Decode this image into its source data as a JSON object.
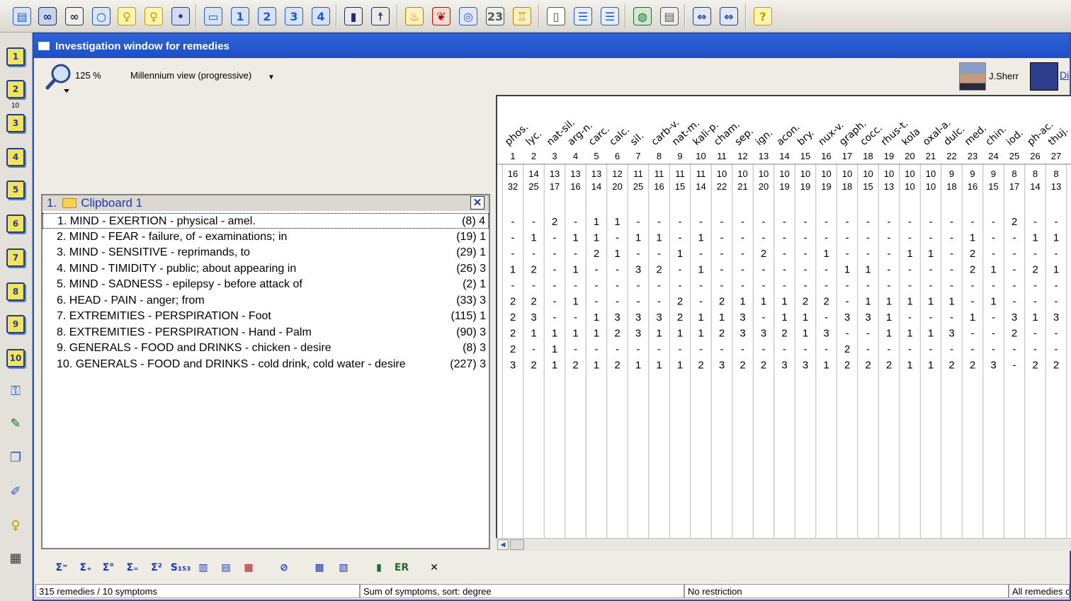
{
  "toolbar": {
    "buttons": [
      "open-book-icon",
      "binoculars-icon",
      "glasses-icon",
      "magnifier-icon",
      "lightbulb-icon",
      "lightbulb-pen-icon",
      "pills-icon",
      "clipboard-icon",
      "clipboard-1-icon",
      "clipboard-2-icon",
      "clipboard-3-icon",
      "clipboard-4-icon",
      "chart-icon",
      "person-chart-icon",
      "flame-icon",
      "insect-icon",
      "circle-icon",
      "numbers-icon",
      "tall-icon",
      "document-add-icon",
      "document-list-icon",
      "document-edit-icon",
      "globe-icon",
      "printer-icon",
      "handshake-icon",
      "handshake2-icon",
      "help-icon"
    ],
    "help_label": "?"
  },
  "sidebar": {
    "books": [
      "1",
      "2",
      "3",
      "4",
      "5",
      "6",
      "7",
      "8",
      "9",
      "10"
    ],
    "count_label": "10",
    "tools": [
      "key-icon",
      "notebook-icon",
      "copy-icon",
      "pencil-icon",
      "lightbulb-icon",
      "map-icon"
    ]
  },
  "window": {
    "title": "Investigation window for remedies",
    "zoom": "125 %",
    "view_mode": "Millennium view (progressive)",
    "user": "J.Sherr",
    "dia_label": "Di"
  },
  "clipboard": {
    "index_label": "1.",
    "title": "Clipboard 1",
    "close_label": "✕",
    "symptoms": [
      {
        "label": "1. MIND - EXERTION - physical - amel.",
        "count": "(8) 4"
      },
      {
        "label": "2. MIND - FEAR - failure, of - examinations; in",
        "count": "(19) 1"
      },
      {
        "label": "3. MIND - SENSITIVE - reprimands, to",
        "count": "(29) 1"
      },
      {
        "label": "4. MIND - TIMIDITY - public; about appearing in",
        "count": "(26) 3"
      },
      {
        "label": "5. MIND - SADNESS - epilepsy - before attack of",
        "count": "(2) 1"
      },
      {
        "label": "6. HEAD - PAIN - anger; from",
        "count": "(33) 3"
      },
      {
        "label": "7. EXTREMITIES - PERSPIRATION - Foot",
        "count": "(115) 1"
      },
      {
        "label": "8. EXTREMITIES - PERSPIRATION - Hand - Palm",
        "count": "(90) 3"
      },
      {
        "label": "9. GENERALS - FOOD and DRINKS - chicken - desire",
        "count": "(8) 3"
      },
      {
        "label": "10. GENERALS - FOOD and DRINKS - cold drink, cold water - desire",
        "count": "(227) 3"
      }
    ]
  },
  "grid": {
    "remedies": [
      "phos.",
      "lyc.",
      "nat-sil.",
      "arg-n.",
      "carc.",
      "calc.",
      "sil.",
      "carb-v.",
      "nat-m.",
      "kali-p.",
      "cham.",
      "sep.",
      "ign.",
      "acon.",
      "bry.",
      "nux-v.",
      "graph.",
      "cocc.",
      "rhus-t.",
      "kola",
      "oxal-a.",
      "dulc.",
      "med.",
      "chin.",
      "iod.",
      "ph-ac.",
      "thuj."
    ],
    "ranks": [
      "1",
      "2",
      "3",
      "4",
      "5",
      "6",
      "7",
      "8",
      "9",
      "10",
      "11",
      "12",
      "13",
      "14",
      "15",
      "16",
      "17",
      "18",
      "19",
      "20",
      "21",
      "22",
      "23",
      "24",
      "25",
      "26",
      "27"
    ],
    "sums": [
      "16",
      "14",
      "13",
      "13",
      "13",
      "12",
      "11",
      "11",
      "11",
      "11",
      "10",
      "10",
      "10",
      "10",
      "10",
      "10",
      "10",
      "10",
      "10",
      "10",
      "10",
      "9",
      "9",
      "9",
      "8",
      "8",
      "8"
    ],
    "degrees": [
      "32",
      "25",
      "17",
      "16",
      "14",
      "20",
      "25",
      "16",
      "15",
      "14",
      "22",
      "21",
      "20",
      "19",
      "19",
      "19",
      "18",
      "15",
      "13",
      "10",
      "10",
      "18",
      "16",
      "15",
      "17",
      "14",
      "13"
    ],
    "rows": [
      [
        "-",
        "-",
        "2",
        "-",
        "1",
        "1",
        "-",
        "-",
        "-",
        "-",
        "-",
        "-",
        "-",
        "-",
        "-",
        "-",
        "-",
        "-",
        "-",
        "-",
        "-",
        "-",
        "-",
        "-",
        "2",
        "-",
        "-"
      ],
      [
        "-",
        "1",
        "-",
        "1",
        "1",
        "-",
        "1",
        "1",
        "-",
        "1",
        "-",
        "-",
        "-",
        "-",
        "-",
        "-",
        "-",
        "-",
        "-",
        "-",
        "-",
        "-",
        "1",
        "-",
        "-",
        "1",
        "1"
      ],
      [
        "-",
        "-",
        "-",
        "-",
        "2",
        "1",
        "-",
        "-",
        "1",
        "-",
        "-",
        "-",
        "2",
        "-",
        "-",
        "1",
        "-",
        "-",
        "-",
        "1",
        "1",
        "-",
        "2",
        "-",
        "-",
        "-",
        "-"
      ],
      [
        "1",
        "2",
        "-",
        "1",
        "-",
        "-",
        "3",
        "2",
        "-",
        "1",
        "-",
        "-",
        "-",
        "-",
        "-",
        "-",
        "1",
        "1",
        "-",
        "-",
        "-",
        "-",
        "2",
        "1",
        "-",
        "2",
        "1"
      ],
      [
        "-",
        "-",
        "-",
        "-",
        "-",
        "-",
        "-",
        "-",
        "-",
        "-",
        "-",
        "-",
        "-",
        "-",
        "-",
        "-",
        "-",
        "-",
        "-",
        "-",
        "-",
        "-",
        "-",
        "-",
        "-",
        "-",
        "-"
      ],
      [
        "2",
        "2",
        "-",
        "1",
        "-",
        "-",
        "-",
        "-",
        "2",
        "-",
        "2",
        "1",
        "1",
        "1",
        "2",
        "2",
        "-",
        "1",
        "1",
        "1",
        "1",
        "1",
        "-",
        "1",
        "-",
        "-",
        "-"
      ],
      [
        "2",
        "3",
        "-",
        "-",
        "1",
        "3",
        "3",
        "3",
        "2",
        "1",
        "1",
        "3",
        "-",
        "1",
        "1",
        "-",
        "3",
        "3",
        "1",
        "-",
        "-",
        "-",
        "1",
        "-",
        "3",
        "1",
        "3"
      ],
      [
        "2",
        "1",
        "1",
        "1",
        "1",
        "2",
        "3",
        "1",
        "1",
        "1",
        "2",
        "3",
        "3",
        "2",
        "1",
        "3",
        "-",
        "-",
        "1",
        "1",
        "1",
        "3",
        "-",
        "-",
        "2",
        "-",
        "-"
      ],
      [
        "2",
        "-",
        "1",
        "-",
        "-",
        "-",
        "-",
        "-",
        "-",
        "-",
        "-",
        "-",
        "-",
        "-",
        "-",
        "-",
        "2",
        "-",
        "-",
        "-",
        "-",
        "-",
        "-",
        "-",
        "-",
        "-",
        "-"
      ],
      [
        "3",
        "2",
        "1",
        "2",
        "1",
        "2",
        "1",
        "1",
        "1",
        "2",
        "3",
        "2",
        "2",
        "3",
        "3",
        "1",
        "2",
        "2",
        "2",
        "1",
        "1",
        "2",
        "2",
        "3",
        "-",
        "2",
        "2"
      ]
    ]
  },
  "bottom_tools": [
    "Σ⁼",
    "Σ₊",
    "Σ°",
    "Σ₌",
    "Σ²",
    "S₁₅₃",
    "chart-a-icon",
    "chart-b-icon",
    "table-icon",
    "clip-icon",
    "grid-a-icon",
    "grid-b-icon",
    "bar-chart-icon",
    "er-icon",
    "✕"
  ],
  "status": {
    "summary": "315 remedies / 10 symptoms",
    "sort": "Sum of symptoms, sort: degree",
    "restriction": "No restriction",
    "filter": "All remedies co"
  },
  "colors": {
    "title_blue": "#1d4fc8",
    "clip_text_blue": "#1a36b8",
    "book_yellow": "#f4e35c"
  }
}
